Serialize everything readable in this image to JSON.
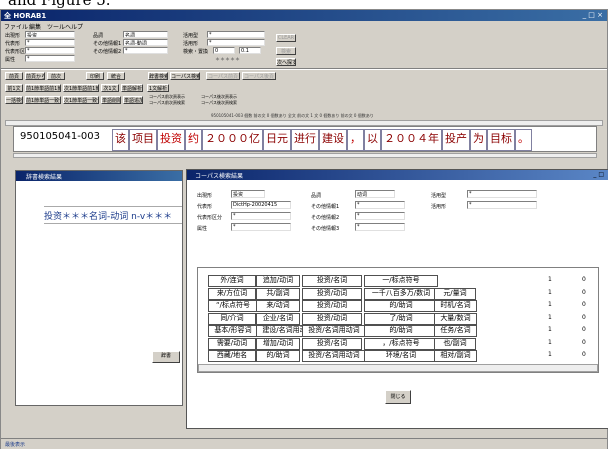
{
  "caption_text": "and Figure 5.",
  "window": {
    "title": "全 HORAB1",
    "controls": "_ □ ×"
  },
  "menu": [
    "ファイル",
    "編集",
    "ツール",
    "ヘルプ"
  ],
  "form": {
    "corpus_label": "出現形",
    "corpus_value": "投资",
    "base_label": "代表形",
    "base_value": "*",
    "class_label": "代表形区分",
    "class_value": "*",
    "type_label": "属性",
    "type_value": "*",
    "pos_label": "品詞",
    "pos_value": "名詞",
    "other1_label": "その他情報1",
    "other1_value": "名詞-動詞",
    "other2_label": "その他情報2",
    "other2_value": "*",
    "useType_label": "活用型",
    "useType_value": "*",
    "useForm_label": "活用形",
    "useForm_value": "*",
    "cond_label": "検索・置換",
    "cond_value": "0",
    "cond2": "0.1",
    "star_text": "＊＊＊＊＊",
    "btn_clear": "CLEAR",
    "btn_search": "検索",
    "btn_replace_next": "次へ探す"
  },
  "toolbar1": [
    "前頁",
    "前頁から",
    "前次",
    "印刷",
    "統合",
    "辞書検索",
    "コーパス検索",
    "コーパス前頁",
    "コーパス後頁"
  ],
  "toolbar2": [
    "前1文",
    "前1節単語前1節",
    "次1節単語前1節",
    "次1文",
    "単語解析",
    "1文解析"
  ],
  "toolbar3": [
    "一括検索",
    "前1節単語一致一括",
    "次1節単語一致一括",
    "単語削除",
    "単語追加"
  ],
  "radios": {
    "a": "コーパス前次頁表示",
    "b": "コーパス後次頁表示",
    "c": "コーパス前次頁検索",
    "d": "コーパス後次頁検索"
  },
  "info_line": "950105041-003 個数 前の文 0 個数あり 全文 前の文 1 文 0 個数あり 前の文 0 個数あり",
  "sentence": {
    "id": "950105041-003",
    "tokens": [
      {
        "t": "该",
        "c": "normal"
      },
      {
        "t": "项目",
        "c": "normal"
      },
      {
        "t": "投资",
        "c": "hl"
      },
      {
        "t": "约",
        "c": "hl"
      },
      {
        "t": "２０００亿",
        "c": "normal"
      },
      {
        "t": "日元",
        "c": "normal"
      },
      {
        "t": "进行",
        "c": "normal"
      },
      {
        "t": "建设",
        "c": "normal"
      },
      {
        "t": "，",
        "c": "hl"
      },
      {
        "t": "以",
        "c": "normal"
      },
      {
        "t": "２００４年",
        "c": "normal"
      },
      {
        "t": "投产",
        "c": "normal"
      },
      {
        "t": "为",
        "c": "normal"
      },
      {
        "t": "目标",
        "c": "normal"
      },
      {
        "t": "。",
        "c": "hl"
      }
    ]
  },
  "left_window": {
    "title": "辞書検索結果",
    "result": "投资＊＊＊名词-动词 n-v＊＊＊",
    "side_btn": "辞書",
    "status": "最後表示"
  },
  "dialog": {
    "title": "コーパス検索結果",
    "fields": {
      "surface_label": "出現形",
      "surface_value": "投资",
      "base_label": "代表形",
      "base_value": "DictHp-20020415",
      "class_label": "代表形区分",
      "class_value": "*",
      "attr_label": "属性",
      "attr_value": "*",
      "pos_label": "品詞",
      "pos_value": "动词",
      "o1_label": "その他情報1",
      "o1_value": "*",
      "o2_label": "その他情報2",
      "o2_value": "*",
      "o3_label": "その他情報3",
      "o3_value": "*",
      "ut_label": "活用型",
      "ut_value": "*",
      "uf_label": "活用形",
      "uf_value": "*"
    },
    "rows": [
      {
        "cells": [
          "外/连词",
          "追加/动词",
          "投资/名词",
          "一/标点符号"
        ],
        "n": "1",
        "m": "0"
      },
      {
        "cells": [
          "来/方位词",
          "共/副词",
          "投资/动词",
          "一千八百多万/数词",
          "元/量词"
        ],
        "n": "1",
        "m": "0"
      },
      {
        "cells": [
          "“/标点符号",
          "来/动词",
          "投资/动词",
          "的/助词",
          "时机/名词"
        ],
        "n": "1",
        "m": "0"
      },
      {
        "cells": [
          "同/介词",
          "企业/名词",
          "投资/动词",
          "了/助词",
          "大量/数词"
        ],
        "n": "1",
        "m": "0"
      },
      {
        "cells": [
          "基本/形容词",
          "建设/名词用动词",
          "投资/名词用动词",
          "的/助词",
          "任务/名词"
        ],
        "n": "1",
        "m": "0"
      },
      {
        "cells": [
          "需要/动词",
          "增加/动词",
          "投资/名词",
          "，/标点符号",
          "也/副词"
        ],
        "n": "1",
        "m": "0"
      },
      {
        "cells": [
          "西藏/地名",
          "的/助词",
          "投资/名词用动词",
          "环境/名词",
          "相对/副词"
        ],
        "n": "1",
        "m": "0"
      }
    ],
    "close_label": "閉じる"
  },
  "colors": {
    "title": "#0a246a",
    "token_red": "#8b0000",
    "result_blue": "#1a3a8a"
  }
}
